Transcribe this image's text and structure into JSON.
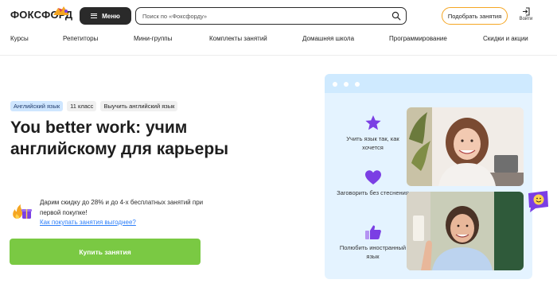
{
  "header": {
    "logo_text": "ФОКСФОРД",
    "menu_label": "Меню",
    "search_placeholder": "Поиск по «Фоксфорду»",
    "pick_button": "Подобрать занятия",
    "login_label": "Войти"
  },
  "nav": {
    "items": [
      {
        "label": "Курсы"
      },
      {
        "label": "Репетиторы"
      },
      {
        "label": "Мини-группы"
      },
      {
        "label": "Комплекты занятий"
      },
      {
        "label": "Домашняя школа"
      },
      {
        "label": "Программирование"
      },
      {
        "label": "Скидки и акции"
      }
    ]
  },
  "hero": {
    "tags": [
      "Английский язык",
      "11 класс",
      "Выучить английский язык"
    ],
    "title": "You better work: учим английскому для карьеры",
    "promo_text": "Дарим скидку до 28% и до 4-х бесплатных занятий при первой покупке!",
    "promo_link": "Как покупать занятия выгоднее?",
    "buy_button": "Купить занятия"
  },
  "card": {
    "features": [
      {
        "text": "Учить язык так, как хочется",
        "icon": "star-icon"
      },
      {
        "text": "Заговорить без стеснения",
        "icon": "heart-icon"
      },
      {
        "text": "Полюбить иностранный язык",
        "icon": "thumbs-up-icon"
      }
    ]
  },
  "colors": {
    "accent_green": "#7ac943",
    "accent_orange": "#f5a623",
    "accent_purple": "#7b3fe4",
    "link_blue": "#2d7ff9",
    "card_bg": "#e4f3ff"
  }
}
